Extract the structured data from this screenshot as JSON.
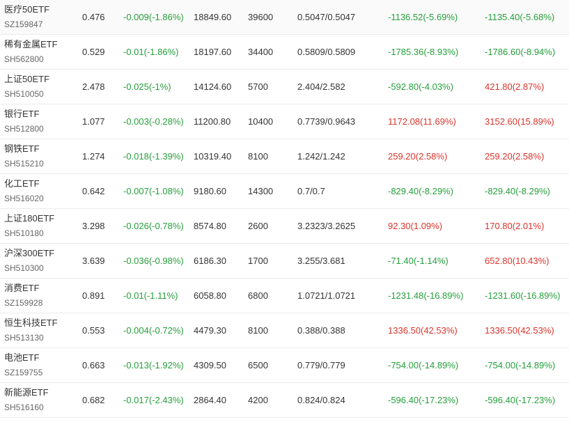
{
  "colors": {
    "up": "#d9342b",
    "down": "#259e3b",
    "text": "#333333",
    "code": "#666666",
    "divider": "#ebebeb"
  },
  "rows": [
    {
      "name": "医疗50ETF",
      "code": "SZ159847",
      "price": "0.476",
      "change": "-0.009(-1.86%)",
      "change_dir": "down",
      "market_value": "18849.60",
      "quantity": "39600",
      "cost": "0.5047/0.5047",
      "day_pl": "-1136.52(-5.69%)",
      "day_pl_dir": "down",
      "total_pl": "-1135.40(-5.68%)",
      "total_pl_dir": "down"
    },
    {
      "name": "稀有金属ETF",
      "code": "SH562800",
      "price": "0.529",
      "change": "-0.01(-1.86%)",
      "change_dir": "down",
      "market_value": "18197.60",
      "quantity": "34400",
      "cost": "0.5809/0.5809",
      "day_pl": "-1785.36(-8.93%)",
      "day_pl_dir": "down",
      "total_pl": "-1786.60(-8.94%)",
      "total_pl_dir": "down"
    },
    {
      "name": "上证50ETF",
      "code": "SH510050",
      "price": "2.478",
      "change": "-0.025(-1%)",
      "change_dir": "down",
      "market_value": "14124.60",
      "quantity": "5700",
      "cost": "2.404/2.582",
      "day_pl": "-592.80(-4.03%)",
      "day_pl_dir": "down",
      "total_pl": "421.80(2.87%)",
      "total_pl_dir": "up"
    },
    {
      "name": "银行ETF",
      "code": "SH512800",
      "price": "1.077",
      "change": "-0.003(-0.28%)",
      "change_dir": "down",
      "market_value": "11200.80",
      "quantity": "10400",
      "cost": "0.7739/0.9643",
      "day_pl": "1172.08(11.69%)",
      "day_pl_dir": "up",
      "total_pl": "3152.60(15.89%)",
      "total_pl_dir": "up"
    },
    {
      "name": "钢铁ETF",
      "code": "SH515210",
      "price": "1.274",
      "change": "-0.018(-1.39%)",
      "change_dir": "down",
      "market_value": "10319.40",
      "quantity": "8100",
      "cost": "1.242/1.242",
      "day_pl": "259.20(2.58%)",
      "day_pl_dir": "up",
      "total_pl": "259.20(2.58%)",
      "total_pl_dir": "up"
    },
    {
      "name": "化工ETF",
      "code": "SH516020",
      "price": "0.642",
      "change": "-0.007(-1.08%)",
      "change_dir": "down",
      "market_value": "9180.60",
      "quantity": "14300",
      "cost": "0.7/0.7",
      "day_pl": "-829.40(-8.29%)",
      "day_pl_dir": "down",
      "total_pl": "-829.40(-8.29%)",
      "total_pl_dir": "down"
    },
    {
      "name": "上证180ETF",
      "code": "SH510180",
      "price": "3.298",
      "change": "-0.026(-0.78%)",
      "change_dir": "down",
      "market_value": "8574.80",
      "quantity": "2600",
      "cost": "3.2323/3.2625",
      "day_pl": "92.30(1.09%)",
      "day_pl_dir": "up",
      "total_pl": "170.80(2.01%)",
      "total_pl_dir": "up"
    },
    {
      "name": "沪深300ETF",
      "code": "SH510300",
      "price": "3.639",
      "change": "-0.036(-0.98%)",
      "change_dir": "down",
      "market_value": "6186.30",
      "quantity": "1700",
      "cost": "3.255/3.681",
      "day_pl": "-71.40(-1.14%)",
      "day_pl_dir": "down",
      "total_pl": "652.80(10.43%)",
      "total_pl_dir": "up"
    },
    {
      "name": "消费ETF",
      "code": "SZ159928",
      "price": "0.891",
      "change": "-0.01(-1.11%)",
      "change_dir": "down",
      "market_value": "6058.80",
      "quantity": "6800",
      "cost": "1.0721/1.0721",
      "day_pl": "-1231.48(-16.89%)",
      "day_pl_dir": "down",
      "total_pl": "-1231.60(-16.89%)",
      "total_pl_dir": "down"
    },
    {
      "name": "恒生科技ETF",
      "code": "SH513130",
      "price": "0.553",
      "change": "-0.004(-0.72%)",
      "change_dir": "down",
      "market_value": "4479.30",
      "quantity": "8100",
      "cost": "0.388/0.388",
      "day_pl": "1336.50(42.53%)",
      "day_pl_dir": "up",
      "total_pl": "1336.50(42.53%)",
      "total_pl_dir": "up"
    },
    {
      "name": "电池ETF",
      "code": "SZ159755",
      "price": "0.663",
      "change": "-0.013(-1.92%)",
      "change_dir": "down",
      "market_value": "4309.50",
      "quantity": "6500",
      "cost": "0.779/0.779",
      "day_pl": "-754.00(-14.89%)",
      "day_pl_dir": "down",
      "total_pl": "-754.00(-14.89%)",
      "total_pl_dir": "down"
    },
    {
      "name": "新能源ETF",
      "code": "SH516160",
      "price": "0.682",
      "change": "-0.017(-2.43%)",
      "change_dir": "down",
      "market_value": "2864.40",
      "quantity": "4200",
      "cost": "0.824/0.824",
      "day_pl": "-596.40(-17.23%)",
      "day_pl_dir": "down",
      "total_pl": "-596.40(-17.23%)",
      "total_pl_dir": "down"
    }
  ]
}
